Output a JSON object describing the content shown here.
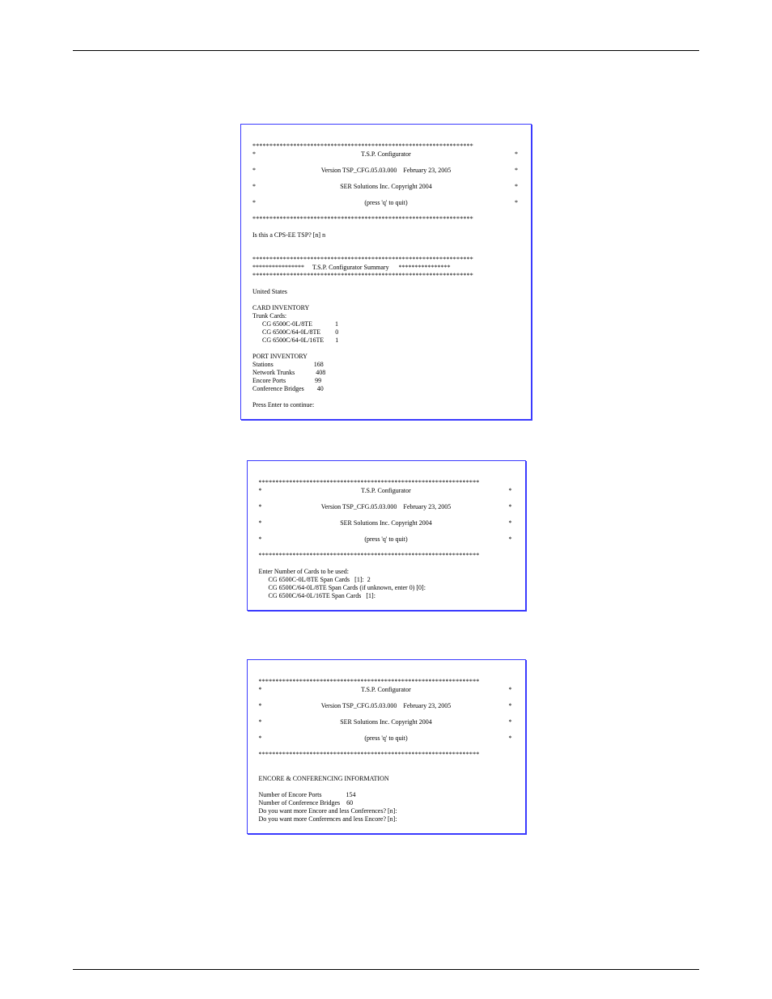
{
  "header": {
    "left": "",
    "right": ""
  },
  "banner": {
    "stars": "*****************************************************************",
    "title": "T.S.P. Configurator",
    "version": "Version TSP_CFG.05.03.000    February 23, 2005",
    "company": "SER Solutions Inc. Copyright 2004",
    "quit": "(press 'q' to quit)"
  },
  "screen1": {
    "q_cps": "Is this a CPS-EE TSP? [n] n",
    "summary_stars_left": "****************",
    "summary_label": "T.S.P. Configurator Summary",
    "summary_stars_right": "****************",
    "country": "United States",
    "card_inv_title": "CARD INVENTORY",
    "trunk_cards_label": "Trunk Cards:",
    "cards": [
      {
        "name": "CG 6500C-0L/8TE",
        "val": "1"
      },
      {
        "name": "CG 6500C/64-0L/8TE",
        "val": "0"
      },
      {
        "name": "CG 6500C/64-0L/16TE",
        "val": "1"
      }
    ],
    "port_inv_title": "PORT INVENTORY",
    "ports": [
      {
        "name": "Stations",
        "val": "168"
      },
      {
        "name": "Network Trunks",
        "val": "408"
      },
      {
        "name": "Encore Ports",
        "val": "99"
      },
      {
        "name": "Conference Bridges",
        "val": "40"
      }
    ],
    "continue": "Press Enter to continue:"
  },
  "caption1": "",
  "screen2": {
    "enter_cards": "Enter Number of Cards to be used:",
    "lines": [
      "CG 6500C-0L/8TE Span Cards   [1]:  2",
      "CG 6500C/64-0L/8TE Span Cards (if unknown, enter 0) [0]:",
      "CG 6500C/64-0L/16TE Span Cards   [1]:"
    ]
  },
  "caption2": "",
  "screen3": {
    "title": "ENCORE & CONFERENCING INFORMATION",
    "rows": [
      {
        "name": "Number of Encore Ports",
        "val": "154"
      },
      {
        "name": "Number of Conference Bridges",
        "val": "60"
      }
    ],
    "q1": "Do you want more Encore and less Conferences? [n]:",
    "q2": "Do you want more Conferences and less Encore? [n]:"
  },
  "caption3": "",
  "footer": {
    "left": "",
    "center": "",
    "right": ""
  }
}
